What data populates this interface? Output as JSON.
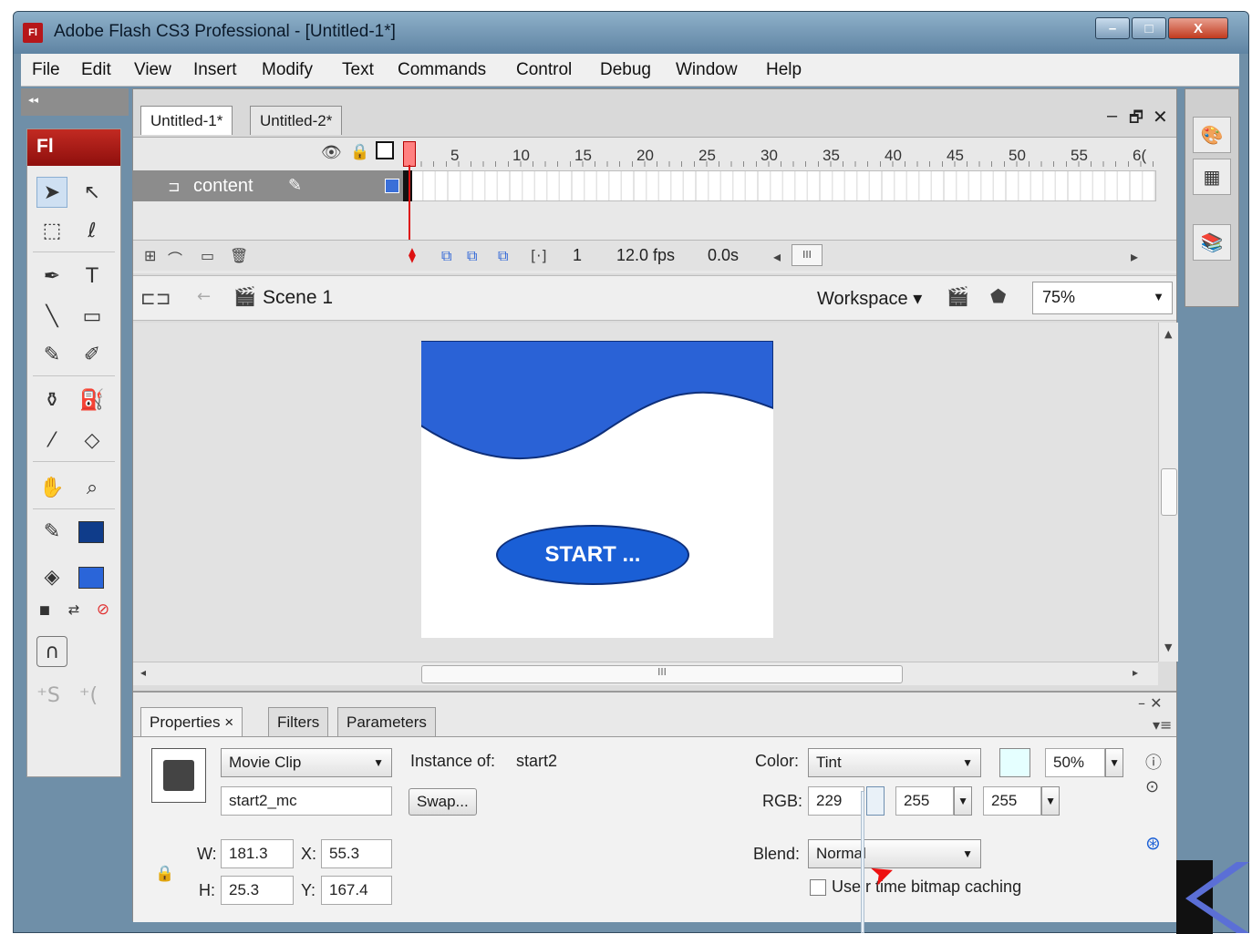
{
  "window": {
    "title": "Adobe Flash CS3 Professional - [Untitled-1*]",
    "logo": "Fl",
    "minimize": "–",
    "maximize": "□",
    "close": "X"
  },
  "menu": [
    "File",
    "Edit",
    "View",
    "Insert",
    "Modify",
    "Text",
    "Commands",
    "Control",
    "Debug",
    "Window",
    "Help"
  ],
  "tools": {
    "badge": "Fl",
    "icons": [
      "selection-arrow-icon",
      "subselection-arrow-icon",
      "free-transform-icon",
      "lasso-icon",
      "pen-icon",
      "text-icon",
      "line-icon",
      "rectangle-icon",
      "pencil-icon",
      "brush-icon",
      "ink-bottle-icon",
      "paint-bucket-icon",
      "eyedropper-icon",
      "eraser-icon",
      "hand-icon",
      "zoom-icon"
    ],
    "stroke_color": "#0f3c8a",
    "fill_color": "#2a65d9",
    "none_color": "#e03030"
  },
  "document": {
    "tabs": [
      {
        "label": "Untitled-1*",
        "active": true
      },
      {
        "label": "Untitled-2*",
        "active": false
      }
    ],
    "controls": {
      "minimize": "–",
      "restore": "🗗",
      "close": "✕"
    }
  },
  "timeline": {
    "ruler": [
      "5",
      "10",
      "15",
      "20",
      "25",
      "30",
      "35",
      "40",
      "45",
      "50",
      "55",
      "6("
    ],
    "layer": {
      "name": "content",
      "color": "#3a6fd8"
    },
    "current_frame": "1",
    "fps": "12.0 fps",
    "time": "0.0s"
  },
  "editbar": {
    "scene": "Scene 1",
    "workspace": "Workspace ▾",
    "zoom": "75%"
  },
  "stage": {
    "wave_color": "#2a62d6",
    "wave_stroke": "#0e2f7a",
    "button_text": "START ..."
  },
  "properties": {
    "tabs": [
      {
        "label": "Properties ×",
        "active": true
      },
      {
        "label": "Filters",
        "active": false
      },
      {
        "label": "Parameters",
        "active": false
      }
    ],
    "symbol_type": "Movie Clip",
    "instance_of_label": "Instance of:",
    "instance_of_value": "start2",
    "instance_name": "start2_mc",
    "swap_label": "Swap...",
    "w_label": "W:",
    "w_value": "181.3",
    "x_label": "X:",
    "x_value": "55.3",
    "h_label": "H:",
    "h_value": "25.3",
    "y_label": "Y:",
    "y_value": "167.4",
    "color_label": "Color:",
    "color_value": "Tint",
    "tint_percent": "50%",
    "rgb_label": "RGB:",
    "r_value": "229",
    "g_value": "255",
    "b_value": "255",
    "blend_label": "Blend:",
    "blend_value": "Normal",
    "bitmap_caching": "Use r  time bitmap caching",
    "tint_swatch": "#e5ffff"
  }
}
